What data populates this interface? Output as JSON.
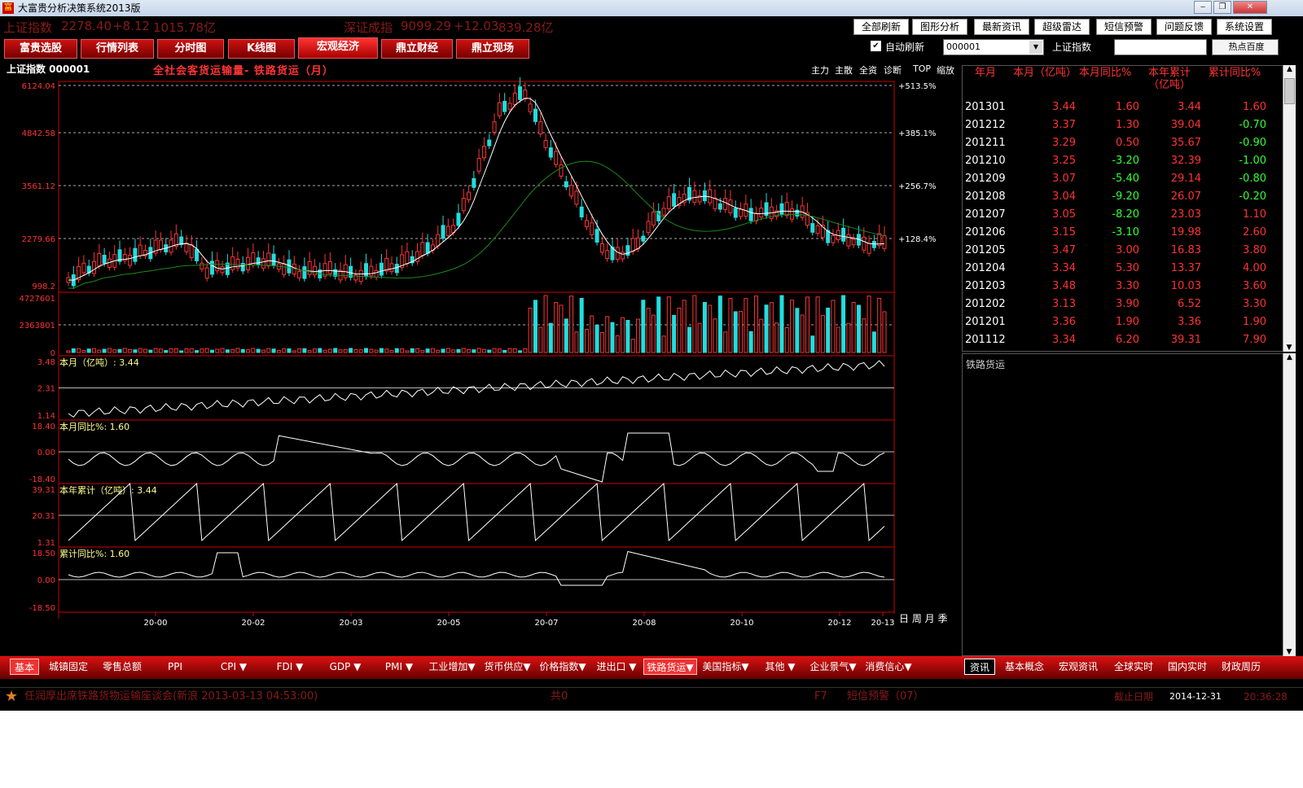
{
  "window": {
    "title": "大富贵分析决策系统2013版",
    "app_icon": "富"
  },
  "ticker": {
    "sh_name": "上证指数",
    "sh_value": "2278.40",
    "sh_change": "+8.12",
    "sh_amount": "1015.78亿",
    "sz_name": "深证成指",
    "sz_value": "9099.29",
    "sz_change": "+12.03",
    "sz_amount": "839.28亿"
  },
  "top_buttons": [
    "全部刷新",
    "图形分析",
    "最新资讯",
    "超级雷达",
    "短信预警",
    "问题反馈",
    "系统设置"
  ],
  "tabs": [
    "富贵选股",
    "行情列表",
    "分时图",
    "K线图",
    "宏观经济",
    "鼎立财经",
    "鼎立现场"
  ],
  "active_tab": "宏观经济",
  "toolbar": {
    "auto_refresh_label": "自动刷新",
    "auto_refresh_checked": true,
    "code_value": "000001",
    "index_label": "上证指数",
    "search_value": "",
    "hot_button": "热点百度"
  },
  "chart": {
    "stock_label": "上证指数 000001",
    "subtitle": "全社会客货运输量- 铁路货运（月）",
    "right_tools": [
      "主力",
      "主散",
      "全资",
      "诊断",
      "TOP",
      "缩放"
    ],
    "price_ticks": [
      "6124.04",
      "4842.58",
      "3561.12",
      "2279.66",
      "998.2"
    ],
    "pct_ticks": [
      "+513.5%",
      "+385.1%",
      "+256.7%",
      "+128.4%"
    ],
    "vol_ticks": [
      "4727601",
      "2363801",
      "0"
    ],
    "panels": [
      {
        "label": "本月（亿吨）: 3.44",
        "ticks": [
          "3.48",
          "2.31",
          "1.14"
        ]
      },
      {
        "label": "本月同比%: 1.60",
        "ticks": [
          "18.40",
          "0.00",
          "-18.40"
        ]
      },
      {
        "label": "本年累计（亿吨）: 3.44",
        "ticks": [
          "39.31",
          "20.31",
          "1.31"
        ]
      },
      {
        "label": "累计同比%: 1.60",
        "ticks": [
          "18.50",
          "0.00",
          "-18.50"
        ]
      }
    ],
    "x_ticks": [
      "20-00",
      "20-02",
      "20-03",
      "20-05",
      "20-07",
      "20-08",
      "20-10",
      "20-12",
      "20-13"
    ],
    "period_labels": "日 周 月 季"
  },
  "table": {
    "headers": [
      "年月",
      "本月（亿吨）",
      "本月同比%",
      "本年累计（亿吨）",
      "累计同比%"
    ],
    "rows": [
      [
        "201301",
        "3.44",
        "1.60",
        "3.44",
        "1.60"
      ],
      [
        "201212",
        "3.37",
        "1.30",
        "39.04",
        "-0.70"
      ],
      [
        "201211",
        "3.29",
        "0.50",
        "35.67",
        "-0.90"
      ],
      [
        "201210",
        "3.25",
        "-3.20",
        "32.39",
        "-1.00"
      ],
      [
        "201209",
        "3.07",
        "-5.40",
        "29.14",
        "-0.80"
      ],
      [
        "201208",
        "3.04",
        "-9.20",
        "26.07",
        "-0.20"
      ],
      [
        "201207",
        "3.05",
        "-8.20",
        "23.03",
        "1.10"
      ],
      [
        "201206",
        "3.15",
        "-3.10",
        "19.98",
        "2.60"
      ],
      [
        "201205",
        "3.47",
        "3.00",
        "16.83",
        "3.80"
      ],
      [
        "201204",
        "3.34",
        "5.30",
        "13.37",
        "4.00"
      ],
      [
        "201203",
        "3.48",
        "3.30",
        "10.03",
        "3.60"
      ],
      [
        "201202",
        "3.13",
        "3.90",
        "6.52",
        "3.30"
      ],
      [
        "201201",
        "3.36",
        "1.90",
        "3.36",
        "1.90"
      ],
      [
        "201112",
        "3.34",
        "6.20",
        "39.31",
        "7.90"
      ]
    ]
  },
  "info_panel_title": "铁路货运",
  "bottom_tabs": [
    "基本",
    "城镇固定",
    "零售总额",
    "PPI",
    "CPI ▼",
    "FDI ▼",
    "GDP ▼",
    "PMI ▼",
    "工业增加▼",
    "货币供应▼",
    "价格指数▼",
    "进出口 ▼",
    "铁路货运▼",
    "美国指标▼",
    "其他 ▼",
    "企业景气▼",
    "消费信心▼"
  ],
  "bottom_active": "铁路货运▼",
  "right_tabs": [
    "资讯",
    "基本概念",
    "宏观资讯",
    "全球实时",
    "国内实时",
    "财政周历"
  ],
  "status": {
    "news": "任润厚出席铁路货物运输座谈会(新浪 2013-03-13 04:53:00)",
    "count": "共0",
    "fkey": "F7",
    "alert": "短信预警（07）",
    "deadline_label": "截止日期",
    "deadline": "2014-12-31",
    "time": "20:36:28"
  }
}
